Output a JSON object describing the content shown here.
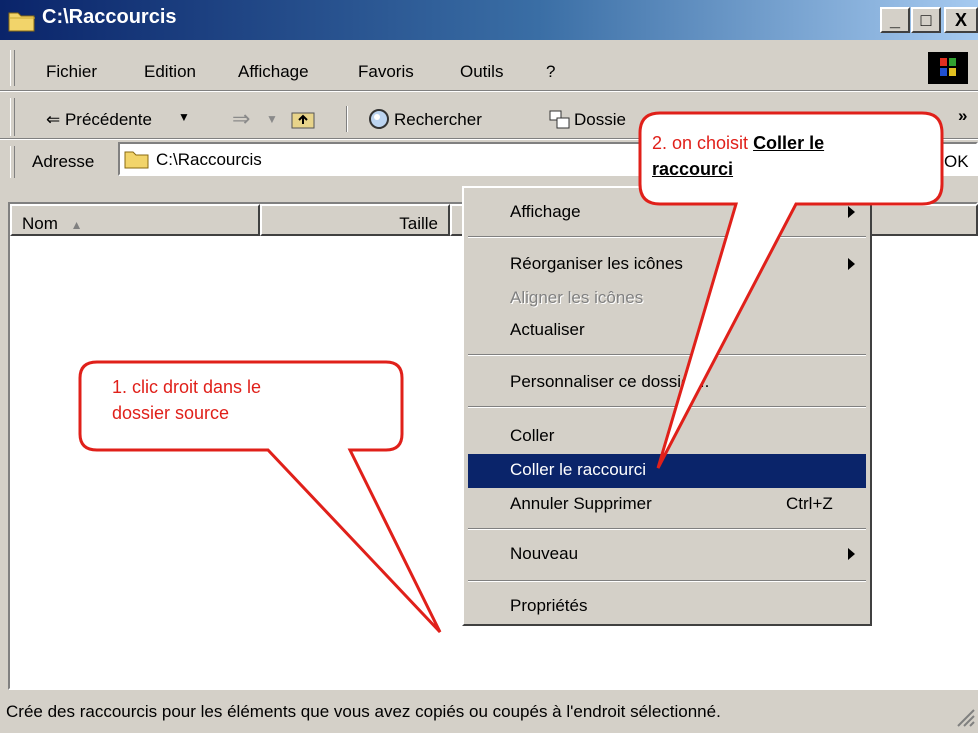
{
  "window": {
    "title": "C:\\Raccourcis",
    "min": "_",
    "max": "□",
    "close": "X"
  },
  "menubar": {
    "items": [
      {
        "label": "Fichier"
      },
      {
        "label": "Edition"
      },
      {
        "label": "Affichage"
      },
      {
        "label": "Favoris"
      },
      {
        "label": "Outils"
      },
      {
        "label": "?"
      }
    ]
  },
  "toolbar": {
    "back_label": "⇐ Précédente",
    "search_label": "Rechercher",
    "folders_label": "Dossiers",
    "more": "»"
  },
  "address": {
    "label": "Adresse",
    "value": "C:\\Raccourcis",
    "go": "OK"
  },
  "columns": [
    {
      "label": "Nom"
    },
    {
      "label": "Taille"
    }
  ],
  "context_menu": {
    "items": [
      {
        "label": "Affichage"
      },
      {
        "label": "Réorganiser les icônes"
      },
      {
        "label": "Aligner les icônes"
      },
      {
        "label": "Actualiser"
      },
      {
        "label": "Personnaliser ce dossier..."
      },
      {
        "label": "Coller"
      },
      {
        "label": "Coller le raccourci"
      },
      {
        "label": "Annuler Supprimer",
        "shortcut": "Ctrl+Z"
      },
      {
        "label": "Nouveau"
      },
      {
        "label": "Propriétés"
      }
    ]
  },
  "callouts": {
    "step1": {
      "line1": "1. clic droit dans le",
      "line2": "dossier source"
    },
    "step2": {
      "prefix": "2. on choisit ",
      "bold1": "Coller le",
      "bold2": "raccourci"
    }
  },
  "statusbar": {
    "text": "Crée des raccourcis pour les éléments que vous avez copiés ou coupés à l'endroit sélectionné."
  },
  "colors": {
    "titlebar": "#0a246a",
    "highlight": "#0a246a",
    "callout_border": "#e0201a",
    "face": "#d4d0c8"
  }
}
